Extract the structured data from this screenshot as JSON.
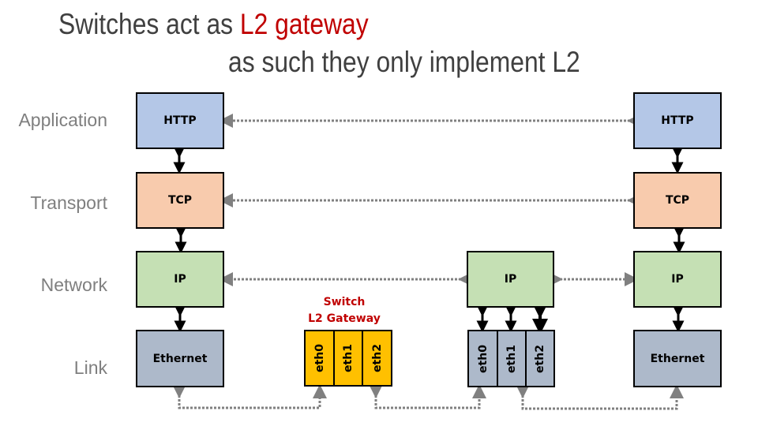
{
  "title": {
    "line1_prefix": "Switches act as ",
    "line1_accent": "L2 gateway",
    "line2": "as such they only implement L2",
    "accent_color": "#c00000"
  },
  "layers": [
    {
      "label": "Application"
    },
    {
      "label": "Transport"
    },
    {
      "label": "Network"
    },
    {
      "label": "Link"
    }
  ],
  "left_host": {
    "http": "HTTP",
    "tcp": "TCP",
    "ip": "IP",
    "ethernet": "Ethernet"
  },
  "right_host": {
    "http": "HTTP",
    "tcp": "TCP",
    "ip": "IP",
    "ethernet": "Ethernet"
  },
  "switch": {
    "label_line1": "Switch",
    "label_line2": "L2 Gateway",
    "ports": [
      "eth0",
      "eth1",
      "eth2"
    ],
    "color": "#ffc000"
  },
  "router": {
    "ip": "IP",
    "ports": [
      "eth0",
      "eth1",
      "eth2"
    ]
  },
  "colors": {
    "http": "#b4c7e7",
    "tcp": "#f8cbad",
    "ip": "#c5e0b4",
    "link": "#adb9ca",
    "dotted_line": "#808080"
  }
}
